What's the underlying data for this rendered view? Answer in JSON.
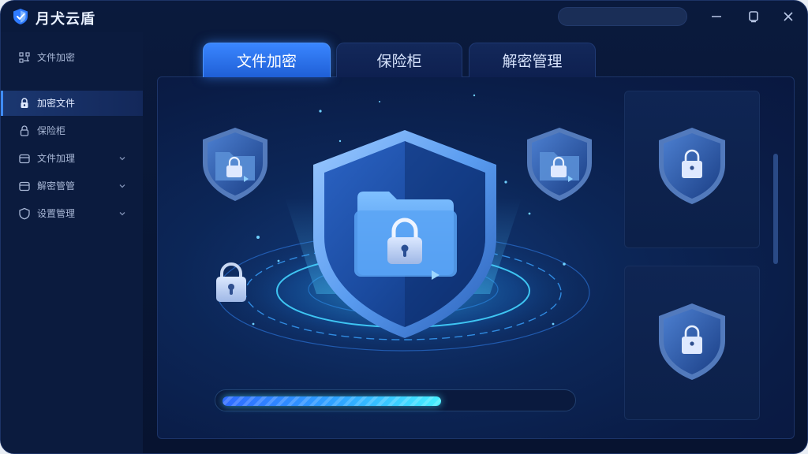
{
  "app": {
    "title": "月犬云盾",
    "logo_icon": "shield-logo-icon"
  },
  "titlebar": {
    "search": {
      "value": ""
    },
    "controls": [
      "minimize-icon",
      "restore-icon",
      "close-icon"
    ]
  },
  "sidebar": {
    "items": [
      {
        "label": "文件加密",
        "icon": "grid-nodes-icon",
        "active": false,
        "has_chevron": false
      },
      {
        "label": "加密文件",
        "icon": "lock-icon",
        "active": true,
        "has_chevron": false
      },
      {
        "label": "保险柜",
        "icon": "lock-outline-icon",
        "active": false,
        "has_chevron": false
      },
      {
        "label": "文件加理",
        "icon": "folder-icon",
        "active": false,
        "has_chevron": true
      },
      {
        "label": "解密管管",
        "icon": "folder-icon",
        "active": false,
        "has_chevron": true
      },
      {
        "label": "设置管理",
        "icon": "shield-outline-icon",
        "active": false,
        "has_chevron": true
      }
    ]
  },
  "tabs": [
    {
      "label": "文件加密",
      "active": true
    },
    {
      "label": "保险柜",
      "active": false
    },
    {
      "label": "解密管理",
      "active": false
    }
  ],
  "progress": {
    "fraction": 0.63
  },
  "colors": {
    "accent": "#3a86ff",
    "background": "#0a1a3d",
    "progress_end": "#46f0ff"
  }
}
